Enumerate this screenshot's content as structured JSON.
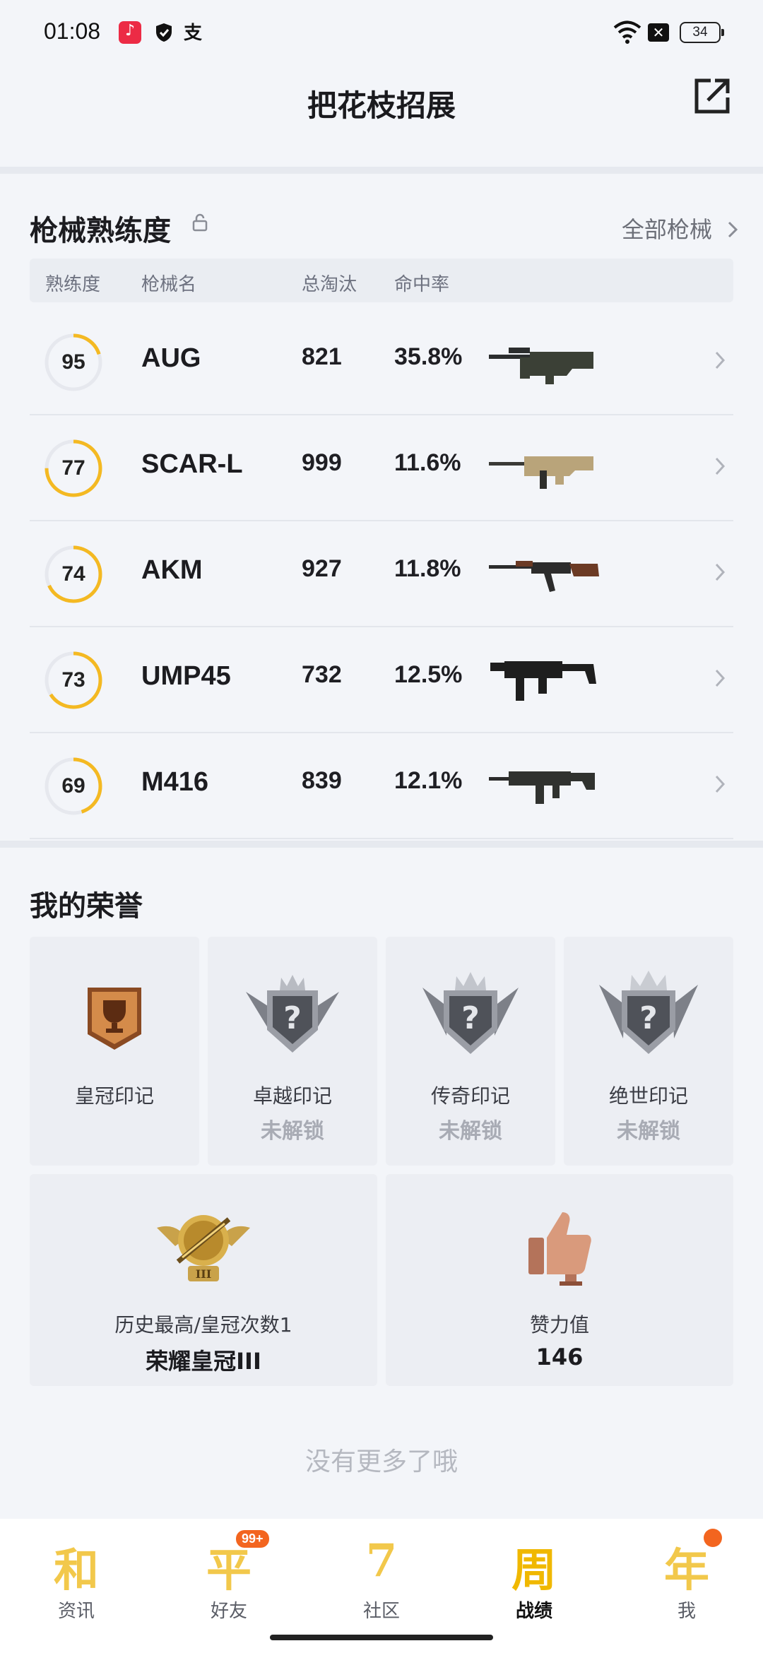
{
  "status_bar": {
    "time": "01:08",
    "alipay": "支",
    "x_box": "✕",
    "battery": "34"
  },
  "header": {
    "title": "把花枝招展"
  },
  "weapons": {
    "title": "枪械熟练度",
    "all_label": "全部枪械",
    "columns": [
      "熟练度",
      "枪械名",
      "总淘汰",
      "命中率"
    ],
    "rows": [
      {
        "mastery": "95",
        "mastery_fraction": 0.2,
        "name": "AUG",
        "kills": "821",
        "rate": "35.8%"
      },
      {
        "mastery": "77",
        "mastery_fraction": 0.75,
        "name": "SCAR-L",
        "kills": "999",
        "rate": "11.6%"
      },
      {
        "mastery": "74",
        "mastery_fraction": 0.68,
        "name": "AKM",
        "kills": "927",
        "rate": "11.8%"
      },
      {
        "mastery": "73",
        "mastery_fraction": 0.66,
        "name": "UMP45",
        "kills": "732",
        "rate": "12.5%"
      },
      {
        "mastery": "69",
        "mastery_fraction": 0.45,
        "name": "M416",
        "kills": "839",
        "rate": "12.1%"
      }
    ]
  },
  "honors": {
    "title": "我的荣誉",
    "marks": [
      {
        "label": "皇冠印记",
        "status": ""
      },
      {
        "label": "卓越印记",
        "status": "未解锁"
      },
      {
        "label": "传奇印记",
        "status": "未解锁"
      },
      {
        "label": "绝世印记",
        "status": "未解锁"
      }
    ],
    "rank": {
      "label": "历史最高/皇冠次数1",
      "value": "荣耀皇冠III"
    },
    "likes": {
      "label": "赞力值",
      "value": "146"
    }
  },
  "footer_text": "没有更多了哦",
  "nav": [
    {
      "glyph": "和",
      "label": "资讯",
      "badge": ""
    },
    {
      "glyph": "平",
      "label": "好友",
      "badge": "99+"
    },
    {
      "glyph": "7",
      "label": "社区",
      "badge": ""
    },
    {
      "glyph": "周",
      "label": "战绩",
      "badge": ""
    },
    {
      "glyph": "年",
      "label": "我",
      "badge": ""
    }
  ],
  "colors": {
    "accent": "#f4b922",
    "ring_track": "#e6e8ee",
    "nav_glyph": "#f2c84b",
    "badge": "#f3651f"
  }
}
